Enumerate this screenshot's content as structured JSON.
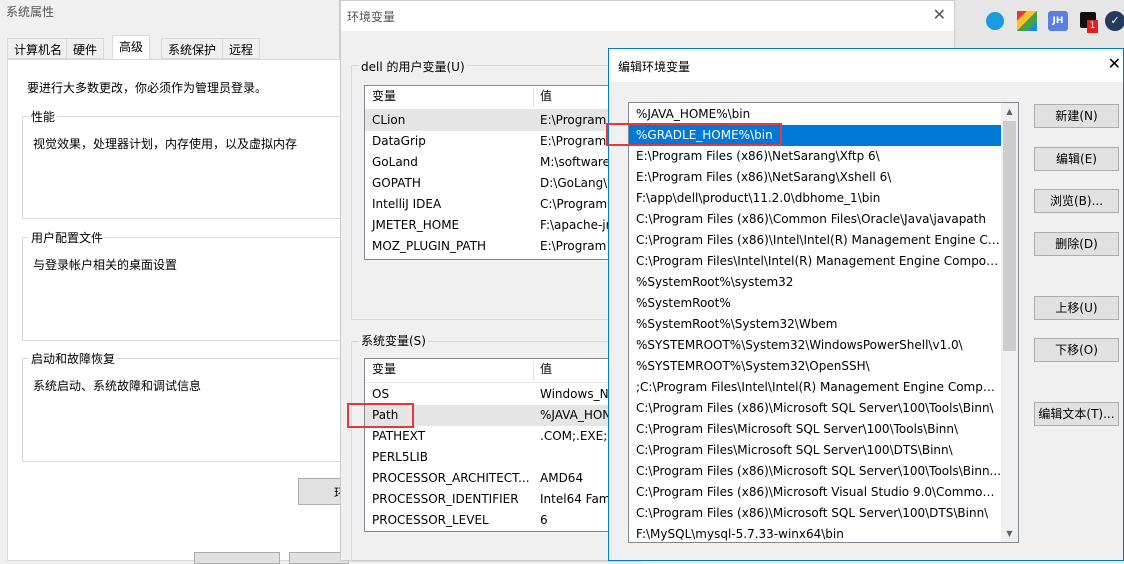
{
  "system_properties": {
    "title": "系统属性",
    "tabs": [
      "计算机名",
      "硬件",
      "高级",
      "系统保护",
      "远程"
    ],
    "active_tab": "高级",
    "admin_note": "要进行大多数更改，你必须作为管理员登录。",
    "performance": {
      "label": "性能",
      "desc": "视觉效果，处理器计划，内存使用，以及虚拟内存"
    },
    "user_profile": {
      "label": "用户配置文件",
      "desc": "与登录帐户相关的桌面设置"
    },
    "startup": {
      "label": "启动和故障恢复",
      "desc": "系统启动、系统故障和调试信息"
    },
    "partial_button": "环"
  },
  "env_vars": {
    "title": "环境变量",
    "close": "✕",
    "user_section": "dell 的用户变量(U)",
    "system_section": "系统变量(S)",
    "col_var": "变量",
    "col_val": "值",
    "user_vars": [
      {
        "name": "CLion",
        "value": "E:\\Program"
      },
      {
        "name": "DataGrip",
        "value": "E:\\Program"
      },
      {
        "name": "GoLand",
        "value": "M:\\software"
      },
      {
        "name": "GOPATH",
        "value": "D:\\GoLang\\"
      },
      {
        "name": "IntelliJ IDEA",
        "value": "C:\\Program"
      },
      {
        "name": "JMETER_HOME",
        "value": "F:\\apache-jr"
      },
      {
        "name": "MOZ_PLUGIN_PATH",
        "value": "E:\\Program"
      }
    ],
    "system_vars": [
      {
        "name": "OS",
        "value": "Windows_N"
      },
      {
        "name": "Path",
        "value": "%JAVA_HON"
      },
      {
        "name": "PATHEXT",
        "value": ".COM;.EXE;."
      },
      {
        "name": "PERL5LIB",
        "value": ""
      },
      {
        "name": "PROCESSOR_ARCHITECT...",
        "value": "AMD64"
      },
      {
        "name": "PROCESSOR_IDENTIFIER",
        "value": "Intel64 Fam"
      },
      {
        "name": "PROCESSOR_LEVEL",
        "value": "6"
      }
    ]
  },
  "edit_env": {
    "title": "编辑环境变量",
    "close": "✕",
    "selected_index": 1,
    "paths": [
      "%JAVA_HOME%\\bin",
      "%GRADLE_HOME%\\bin",
      "E:\\Program Files (x86)\\NetSarang\\Xftp 6\\",
      "E:\\Program Files (x86)\\NetSarang\\Xshell 6\\",
      "F:\\app\\dell\\product\\11.2.0\\dbhome_1\\bin",
      "C:\\Program Files (x86)\\Common Files\\Oracle\\Java\\javapath",
      "C:\\Program Files (x86)\\Intel\\Intel(R) Management Engine Co...",
      "C:\\Program Files\\Intel\\Intel(R) Management Engine Compon...",
      "%SystemRoot%\\system32",
      "%SystemRoot%",
      "%SystemRoot%\\System32\\Wbem",
      "%SYSTEMROOT%\\System32\\WindowsPowerShell\\v1.0\\",
      "%SYSTEMROOT%\\System32\\OpenSSH\\",
      ";C:\\Program Files\\Intel\\Intel(R) Management Engine Compon...",
      "C:\\Program Files (x86)\\Microsoft SQL Server\\100\\Tools\\Binn\\",
      "C:\\Program Files\\Microsoft SQL Server\\100\\Tools\\Binn\\",
      "C:\\Program Files\\Microsoft SQL Server\\100\\DTS\\Binn\\",
      "C:\\Program Files (x86)\\Microsoft SQL Server\\100\\Tools\\Binn...",
      "C:\\Program Files (x86)\\Microsoft Visual Studio 9.0\\Common7...",
      "C:\\Program Files (x86)\\Microsoft SQL Server\\100\\DTS\\Binn\\",
      "F:\\MySQL\\mysql-5.7.33-winx64\\bin"
    ],
    "buttons": {
      "new": "新建(N)",
      "edit": "编辑(E)",
      "browse": "浏览(B)...",
      "delete": "删除(D)",
      "up": "上移(U)",
      "down": "下移(O)",
      "edit_text": "编辑文本(T)..."
    }
  },
  "taskbar": {
    "badge": "1",
    "jh_label": "JH"
  },
  "colors": {
    "accent": "#0078d7",
    "highlight_box": "#e0393e"
  }
}
